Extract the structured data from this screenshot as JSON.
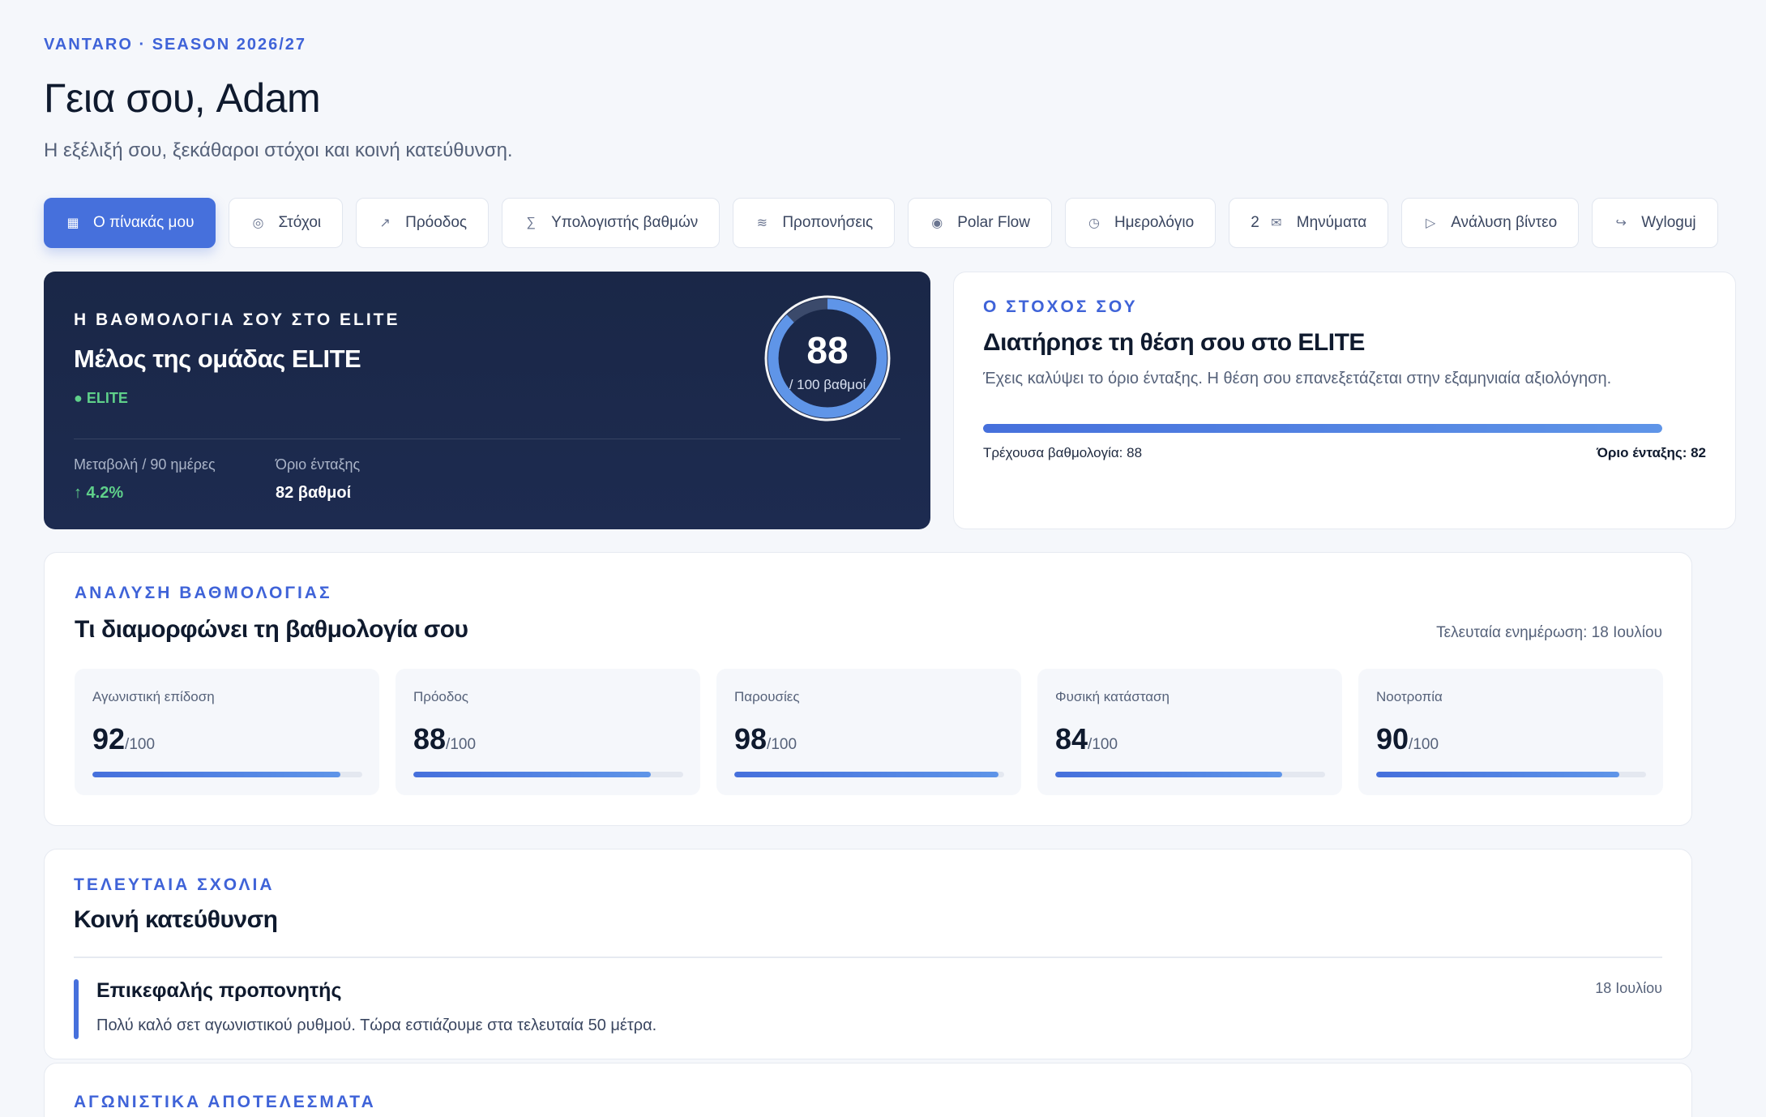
{
  "header": {
    "eyebrow": "VANTARO · SEASON 2026/27",
    "greeting": "Γεια σου, Adam",
    "subtitle": "Η εξέλιξή σου, ξεκάθαροι στόχοι και κοινή κατεύθυνση."
  },
  "nav": [
    {
      "icon": "grid-icon",
      "glyph": "▦",
      "label": "Ο πίνακάς μου",
      "active": true
    },
    {
      "icon": "target-icon",
      "glyph": "◎",
      "label": "Στόχοι"
    },
    {
      "icon": "trend-icon",
      "glyph": "↗",
      "label": "Πρόοδος"
    },
    {
      "icon": "sigma-icon",
      "glyph": "∑",
      "label": "Υπολογιστής βαθμών"
    },
    {
      "icon": "wave-icon",
      "glyph": "≋",
      "label": "Προπονήσεις"
    },
    {
      "icon": "dot-circle-icon",
      "glyph": "◉",
      "label": "Polar Flow"
    },
    {
      "icon": "clock-icon",
      "glyph": "◷",
      "label": "Ημερολόγιο"
    },
    {
      "icon": "mail-icon",
      "glyph": "✉",
      "label": "Μηνύματα",
      "count": "2"
    },
    {
      "icon": "play-icon",
      "glyph": "▷",
      "label": "Ανάλυση βίντεο"
    },
    {
      "icon": "logout-icon",
      "glyph": "↪",
      "label": "Wyloguj"
    }
  ],
  "score_card": {
    "eyebrow": "Η ΒΑΘΜΟΛΟΓΙΑ ΣΟΥ ΣΤΟ ELITE",
    "title": "Μέλος της ομάδας ELITE",
    "badge": "● ELITE",
    "change_label": "Μεταβολή / 90 ημέρες",
    "change_value": "↑ 4.2%",
    "threshold_label": "Όριο ένταξης",
    "threshold_value": "82 βαθμοί",
    "score": "88",
    "score_sub": "/ 100 βαθμοί",
    "score_fraction": 0.88
  },
  "goal_card": {
    "eyebrow": "Ο ΣΤΟΧΟΣ ΣΟΥ",
    "title": "Διατήρησε τη θέση σου στο ELITE",
    "description": "Έχεις καλύψει το όριο ένταξης. Η θέση σου επανεξετάζεται στην εξαμηνιαία αξιολόγηση.",
    "progress_percent": 100,
    "current_label": "Τρέχουσα βαθμολογία: 88",
    "threshold_label": "Όριο ένταξης: 82"
  },
  "breakdown": {
    "eyebrow": "ΑΝΑΛΥΣΗ ΒΑΘΜΟΛΟΓΙΑΣ",
    "title": "Τι διαμορφώνει τη βαθμολογία σου",
    "updated": "Τελευταία ενημέρωση: 18 Ιουλίου",
    "metrics": [
      {
        "label": "Αγωνιστική επίδοση",
        "value": "92",
        "out_of": "/100",
        "percent": 92
      },
      {
        "label": "Πρόοδος",
        "value": "88",
        "out_of": "/100",
        "percent": 88
      },
      {
        "label": "Παρουσίες",
        "value": "98",
        "out_of": "/100",
        "percent": 98
      },
      {
        "label": "Φυσική κατάσταση",
        "value": "84",
        "out_of": "/100",
        "percent": 84
      },
      {
        "label": "Νοοτροπία",
        "value": "90",
        "out_of": "/100",
        "percent": 90
      }
    ]
  },
  "comments": {
    "eyebrow": "ΤΕΛΕΥΤΑΙΑ ΣΧΟΛΙΑ",
    "title": "Κοινή κατεύθυνση",
    "items": [
      {
        "author": "Επικεφαλής προπονητής",
        "date": "18 Ιουλίου",
        "text": "Πολύ καλό σετ αγωνιστικού ρυθμού. Τώρα εστιάζουμε στα τελευταία 50 μέτρα."
      }
    ]
  },
  "results": {
    "eyebrow": "ΑΓΩΝΙΣΤΙΚΑ ΑΠΟΤΕΛΕΣΜΑΤΑ"
  }
}
